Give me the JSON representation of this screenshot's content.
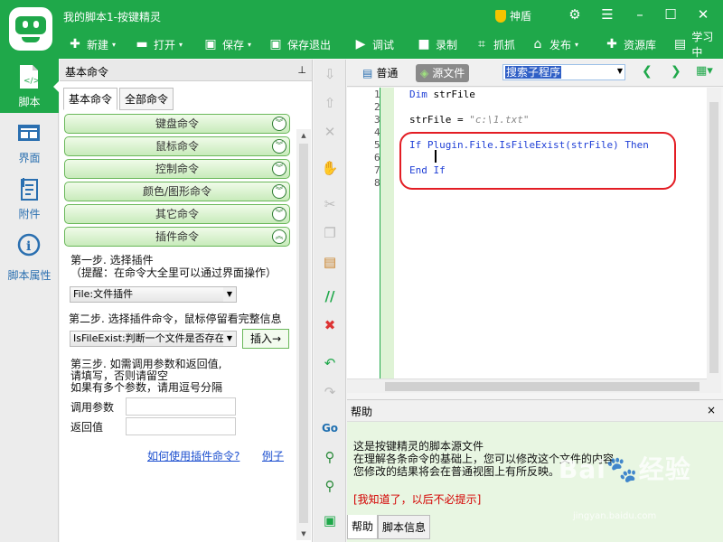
{
  "header": {
    "title": "我的脚本1-按键精灵",
    "shen_label": "神盾",
    "toolbar": [
      {
        "label": "新建",
        "icon": "plus-icon"
      },
      {
        "label": "打开",
        "icon": "folder-icon"
      },
      {
        "label": "保存",
        "icon": "save-icon"
      },
      {
        "label": "保存退出",
        "icon": "save-exit-icon"
      },
      {
        "label": "调试",
        "icon": "play-icon"
      },
      {
        "label": "录制",
        "icon": "camera-icon"
      },
      {
        "label": "抓抓",
        "icon": "grab-icon"
      },
      {
        "label": "发布",
        "icon": "publish-icon"
      },
      {
        "label": "资源库",
        "icon": "library-icon"
      },
      {
        "label": "学习中",
        "icon": "learn-icon"
      }
    ]
  },
  "left_nav": [
    {
      "label": "脚本",
      "icon": "script-icon",
      "active": true
    },
    {
      "label": "界面",
      "icon": "interface-icon"
    },
    {
      "label": "附件",
      "icon": "attachment-icon"
    },
    {
      "label": "脚本属性",
      "icon": "info-icon"
    }
  ],
  "cmd_panel": {
    "title": "基本命令",
    "tabs": [
      "基本命令",
      "全部命令"
    ],
    "categories": [
      "键盘命令",
      "鼠标命令",
      "控制命令",
      "颜色/图形命令",
      "其它命令",
      "插件命令"
    ],
    "step1": "第一步. 选择插件",
    "step1_hint": "（提醒：在命令大全里可以通过界面操作）",
    "plugin_select": "File:文件插件",
    "step2": "第二步. 选择插件命令，鼠标停留看完整信息",
    "command_select": "IsFileExist:判断一个文件是否存在",
    "insert_button": "插入→",
    "step3_line1": "第三步. 如需调用参数和返回值,",
    "step3_line2": "请填写，否则请留空",
    "step3_line3": "如果有多个参数，请用逗号分隔",
    "param_label": "调用参数",
    "return_label": "返回值",
    "link_howto": "如何使用插件命令?",
    "link_example": "例子"
  },
  "editor": {
    "tab_normal": "普通",
    "tab_source": "源文件",
    "search_text": "搜索子程序",
    "line_numbers": [
      "1",
      "2",
      "3",
      "4",
      "5",
      "6",
      "7",
      "8"
    ],
    "code": {
      "l1_kw": "Dim",
      "l1_rest": " strFile",
      "l3_a": "strFile = ",
      "l3_str": "\"c:\\1.txt\"",
      "l5_if": "If",
      "l5_mid": " Plugin.File.IsFileExist(strFile) ",
      "l5_then": "Then",
      "l7": "End If"
    }
  },
  "help": {
    "title": "帮助",
    "close": "×",
    "line1": "这是按键精灵的脚本源文件",
    "line2": "在理解各条命令的基础上，您可以修改这个文件的内容",
    "line3": "您修改的结果将会在普通视图上有所反映。",
    "dismiss": "[我知道了，以后不必提示]",
    "tabs": [
      "帮助",
      "脚本信息"
    ]
  },
  "watermark": {
    "main": "Bai",
    "domain": "jingyan.baidu.com",
    "cn": "经验"
  }
}
